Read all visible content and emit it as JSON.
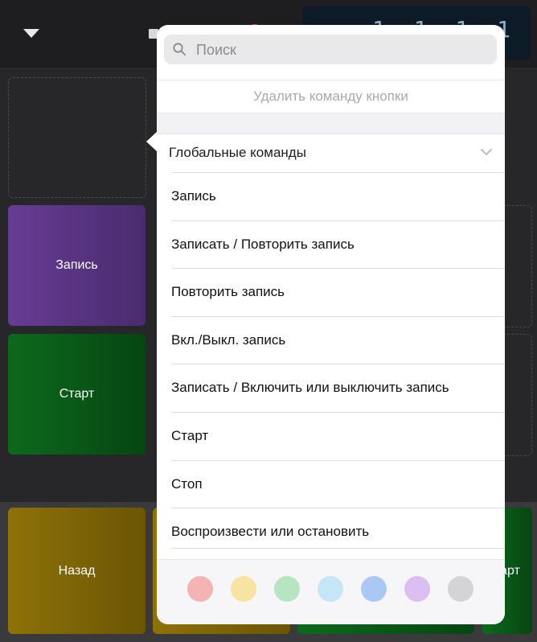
{
  "background": {
    "lcd_text": "1 1 1   1",
    "pads": {
      "record": "Запись",
      "start": "Старт",
      "back": "Назад",
      "start_partial": "тарт"
    },
    "colors": {
      "purple": "#5b3585",
      "green": "#0a5a18",
      "gold": "#7d6406"
    }
  },
  "popover": {
    "search": {
      "placeholder": "Поиск",
      "icon": "search-icon"
    },
    "delete_label": "Удалить команду кнопки",
    "section": {
      "label": "Глобальные команды",
      "icon": "chevron-down-icon"
    },
    "items": [
      {
        "label": "Запись"
      },
      {
        "label": "Записать / Повторить запись"
      },
      {
        "label": "Повторить запись"
      },
      {
        "label": "Вкл./Выкл. запись"
      },
      {
        "label": "Записать / Включить или выключить запись"
      },
      {
        "label": "Старт"
      },
      {
        "label": "Стоп"
      },
      {
        "label": "Воспроизвести или остановить"
      }
    ],
    "color_swatches": [
      "#f4b4b4",
      "#f7e3a2",
      "#b7e4c1",
      "#c5e6f6",
      "#a9c9f4",
      "#dbbff2",
      "#d4d4d8"
    ]
  }
}
